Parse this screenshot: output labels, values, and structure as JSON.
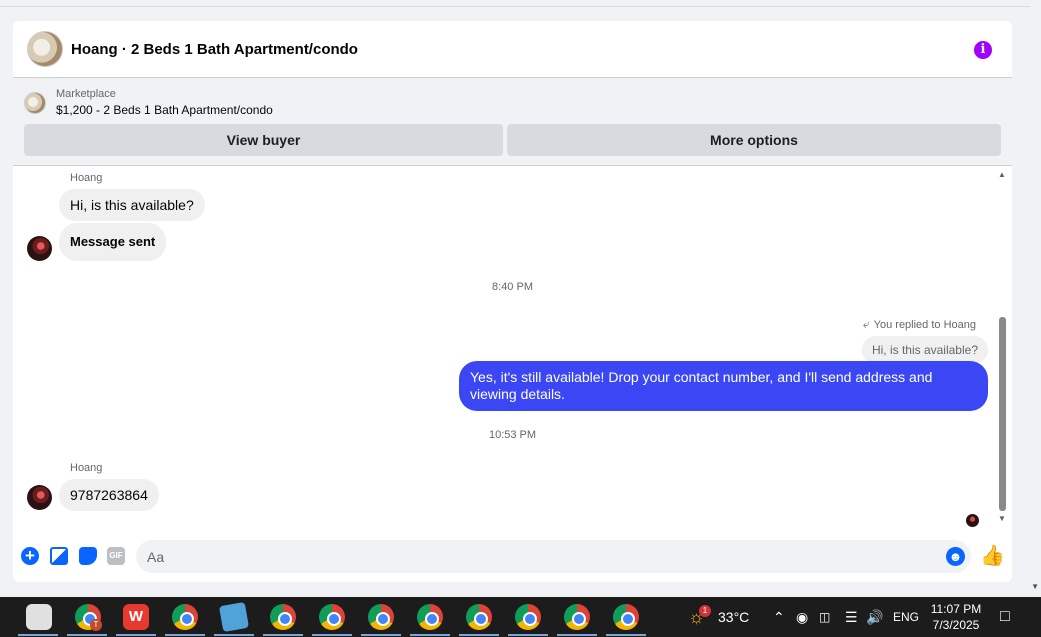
{
  "header": {
    "title": "Hoang · 2 Beds 1 Bath Apartment/condo"
  },
  "listing": {
    "category": "Marketplace",
    "title": "$1,200 - 2 Beds 1 Bath Apartment/condo",
    "view_buyer_label": "View buyer",
    "more_options_label": "More options"
  },
  "messages": {
    "sender_1": "Hoang",
    "msg_1": "Hi, is this available?",
    "msg_2": "Message sent",
    "time_1": "8:40 PM",
    "replied_label": "You replied to Hoang",
    "quoted": "Hi, is this available?",
    "outgoing": "Yes, it's still available! Drop your contact number, and I'll send address and viewing details.",
    "time_2": "10:53 PM",
    "sender_2": "Hoang",
    "msg_3": "9787263864"
  },
  "composer": {
    "placeholder": "Aa",
    "gif_label": "GIF"
  },
  "taskbar": {
    "weather_temp": "33°C",
    "weather_badge": "1",
    "language": "ENG",
    "time": "11:07 PM",
    "date": "7/3/2025",
    "chrome_badge": "T"
  },
  "colors": {
    "accent": "#0866ff",
    "outgoing_bubble": "#3b47f5",
    "info": "#a100ff"
  }
}
